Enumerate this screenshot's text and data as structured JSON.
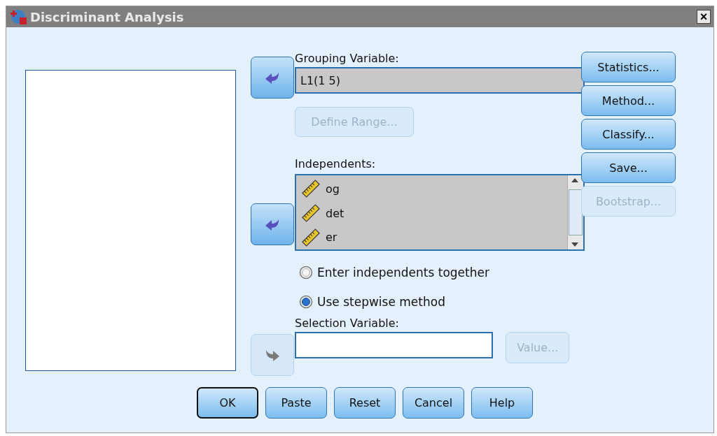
{
  "window": {
    "title": "Discriminant Analysis",
    "close": "×"
  },
  "grouping": {
    "label": "Grouping Variable:",
    "value": "L1(1 5)",
    "move_button": {
      "kind": "left",
      "disabled": false
    },
    "define_range": {
      "label": "Define Range...",
      "disabled": true
    }
  },
  "independents": {
    "label": "Independents:",
    "move_button": {
      "kind": "left",
      "disabled": false
    },
    "items": [
      {
        "name": "og",
        "kind": "scale"
      },
      {
        "name": "det",
        "kind": "scale"
      },
      {
        "name": "er",
        "kind": "scale"
      }
    ]
  },
  "method": [
    {
      "label": "Enter independents together",
      "selected": false
    },
    {
      "label": "Use stepwise method",
      "selected": true
    }
  ],
  "selection": {
    "label": "Selection Variable:",
    "move_button": {
      "kind": "right",
      "disabled": true
    },
    "value_button": {
      "label": "Value...",
      "disabled": true
    }
  },
  "side_buttons": [
    {
      "label": "Statistics...",
      "disabled": false
    },
    {
      "label": "Method...",
      "disabled": false
    },
    {
      "label": "Classify...",
      "disabled": false
    },
    {
      "label": "Save...",
      "disabled": false
    },
    {
      "label": "Bootstrap...",
      "disabled": true
    }
  ],
  "bottom_buttons": [
    {
      "label": "OK",
      "default": true
    },
    {
      "label": "Paste",
      "default": false
    },
    {
      "label": "Reset",
      "default": false
    },
    {
      "label": "Cancel",
      "default": false
    },
    {
      "label": "Help",
      "default": false
    }
  ]
}
